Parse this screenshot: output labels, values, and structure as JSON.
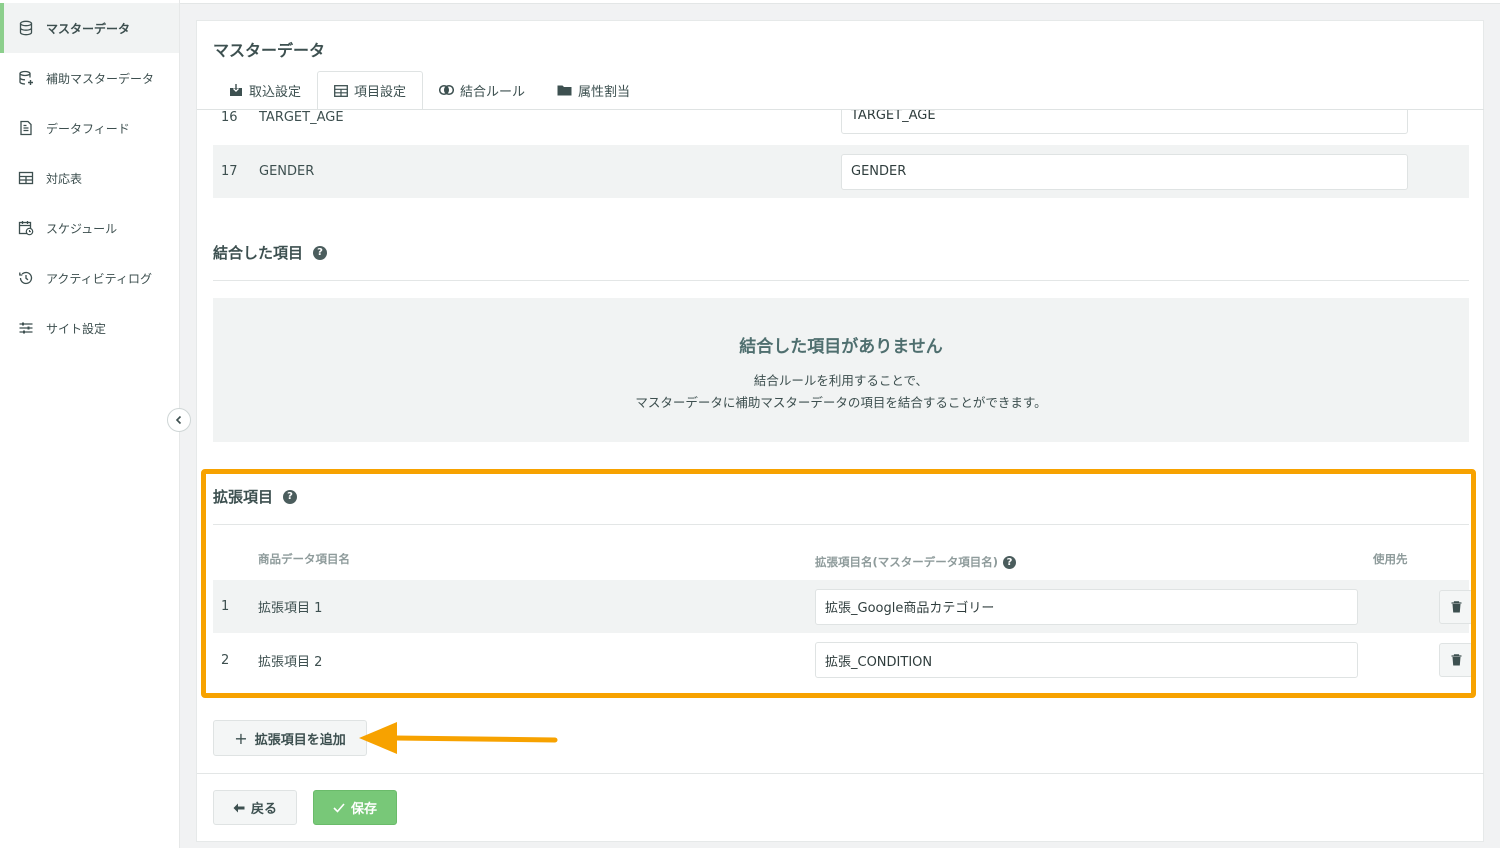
{
  "sidebar": {
    "items": [
      {
        "label": "マスターデータ",
        "icon": "database-icon",
        "active": true
      },
      {
        "label": "補助マスターデータ",
        "icon": "database-add-icon"
      },
      {
        "label": "データフィード",
        "icon": "document-icon"
      },
      {
        "label": "対応表",
        "icon": "table-icon"
      },
      {
        "label": "スケジュール",
        "icon": "calendar-clock-icon"
      },
      {
        "label": "アクティビティログ",
        "icon": "history-icon"
      },
      {
        "label": "サイト設定",
        "icon": "sliders-icon"
      }
    ]
  },
  "page": {
    "title": "マスターデータ",
    "tabs": [
      {
        "label": "取込設定",
        "icon": "import-icon"
      },
      {
        "label": "項目設定",
        "icon": "table-icon",
        "active": true
      },
      {
        "label": "結合ルール",
        "icon": "link-icon"
      },
      {
        "label": "属性割当",
        "icon": "folder-icon"
      }
    ]
  },
  "columns": [
    {
      "num": "16",
      "name": "TARGET_AGE",
      "value": "TARGET_AGE"
    },
    {
      "num": "17",
      "name": "GENDER",
      "value": "GENDER"
    }
  ],
  "joined": {
    "title": "結合した項目",
    "empty_title": "結合した項目がありません",
    "empty_line1": "結合ルールを利用することで、",
    "empty_line2": "マスターデータに補助マスターデータの項目を結合することができます。"
  },
  "extension": {
    "title": "拡張項目",
    "col_name": "商品データ項目名",
    "col_ext": "拡張項目名(マスターデータ項目名)",
    "col_use": "使用先",
    "rows": [
      {
        "num": "1",
        "name": "拡張項目 1",
        "value": "拡張_Google商品カテゴリー"
      },
      {
        "num": "2",
        "name": "拡張項目 2",
        "value": "拡張_CONDITION"
      }
    ],
    "add_label": "拡張項目を追加"
  },
  "footer": {
    "back_label": "戻る",
    "save_label": "保存"
  },
  "colors": {
    "accent_green": "#78c878",
    "highlight_orange": "#f7a200"
  }
}
